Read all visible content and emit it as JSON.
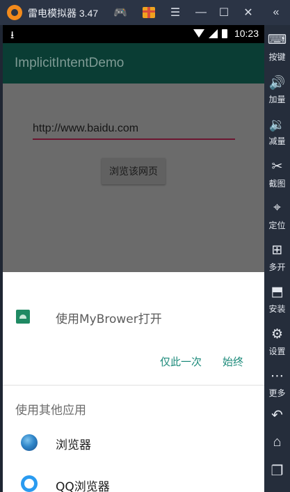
{
  "window": {
    "title": "雷电模拟器 3.47",
    "menu_glyph": "☰",
    "minimize_glyph": "—",
    "maximize_glyph": "☐",
    "close_glyph": "✕",
    "collapse_glyph": "«",
    "gamepad_glyph": "🎮"
  },
  "status_bar": {
    "time": "10:23",
    "download_glyph": "⭳"
  },
  "app_bar": {
    "title": "ImplicitIntentDemo"
  },
  "content": {
    "url_value": "http://www.baidu.com",
    "browse_button": "浏览该网页"
  },
  "chooser": {
    "open_with": "使用MyBrower打开",
    "just_once": "仅此一次",
    "always": "始终",
    "other_apps_header": "使用其他应用",
    "apps": [
      {
        "label": "浏览器",
        "icon": "globe-icon"
      },
      {
        "label": "QQ浏览器",
        "icon": "qq-browser-icon"
      }
    ]
  },
  "sidebar": {
    "items": [
      {
        "label": "按键",
        "glyph": "⌨",
        "icon": "keyboard-icon"
      },
      {
        "label": "加量",
        "glyph": "🔊",
        "icon": "volume-up-icon"
      },
      {
        "label": "减量",
        "glyph": "🔉",
        "icon": "volume-down-icon"
      },
      {
        "label": "截图",
        "glyph": "✂",
        "icon": "scissors-icon"
      },
      {
        "label": "定位",
        "glyph": "⌖",
        "icon": "location-icon"
      },
      {
        "label": "多开",
        "glyph": "⊞",
        "icon": "multi-open-icon"
      },
      {
        "label": "安装",
        "glyph": "⬒",
        "icon": "apk-install-icon"
      },
      {
        "label": "设置",
        "glyph": "⚙",
        "icon": "gear-icon"
      },
      {
        "label": "更多",
        "glyph": "⋯",
        "icon": "more-icon"
      }
    ],
    "nav": {
      "back_glyph": "↶",
      "home_glyph": "⌂",
      "recents_glyph": "❐"
    }
  },
  "colors": {
    "app_bar": "#0a3d34",
    "accent": "#1c8a7a",
    "underline": "#6b1530",
    "emulator_chrome": "#2b3445"
  }
}
